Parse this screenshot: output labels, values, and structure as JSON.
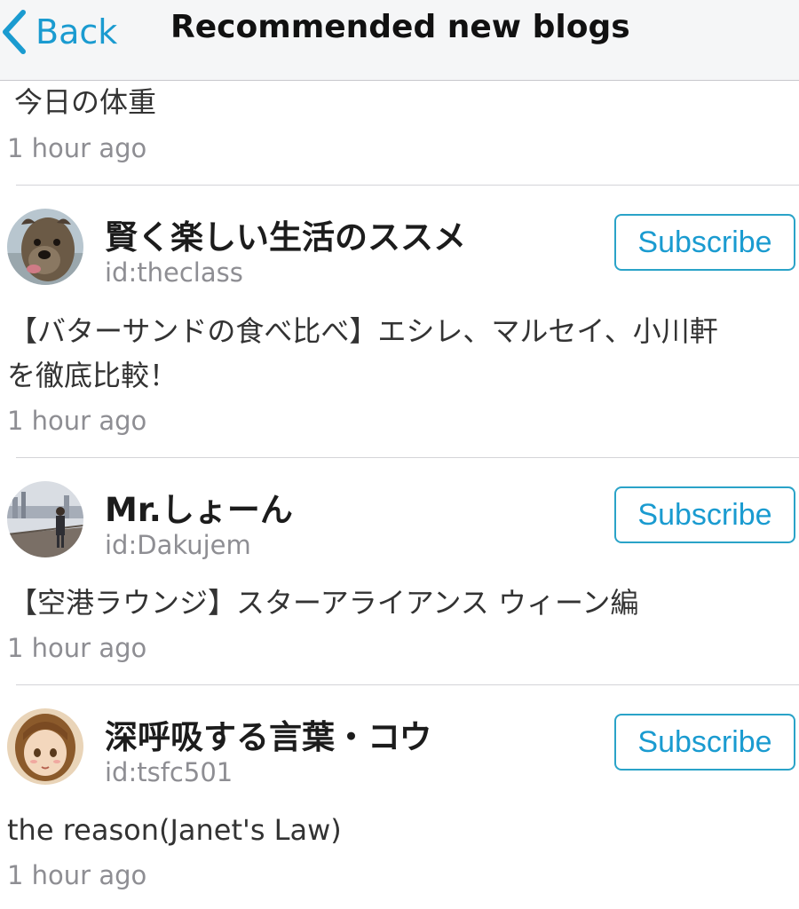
{
  "nav": {
    "back_label": "Back",
    "title": "Recommended new blogs"
  },
  "colors": {
    "accent": "#1a9bd0",
    "muted_text": "#8e8e93"
  },
  "top_post": {
    "title": "今日の体重",
    "time": "1 hour ago"
  },
  "blogs": [
    {
      "name": "賢く楽しい生活のススメ",
      "id": "id:theclass",
      "avatar_icon": "dog-avatar",
      "subscribe_label": "Subscribe",
      "post_lines": [
        "【バターサンドの食べ比べ】エシレ、マルセイ、小川軒",
        "を徹底比較！"
      ],
      "time": "1 hour ago"
    },
    {
      "name": "Mr.しょーん",
      "id": "id:Dakujem",
      "avatar_icon": "person-on-bridge-avatar",
      "subscribe_label": "Subscribe",
      "post_lines": [
        "【空港ラウンジ】スターアライアンス ウィーン編"
      ],
      "time": "1 hour ago"
    },
    {
      "name": "深呼吸する言葉・コウ",
      "id": "id:tsfc501",
      "avatar_icon": "cartoon-girl-avatar",
      "subscribe_label": "Subscribe",
      "post_lines": [
        "the reason(Janet's Law)"
      ],
      "time": "1 hour ago"
    }
  ]
}
